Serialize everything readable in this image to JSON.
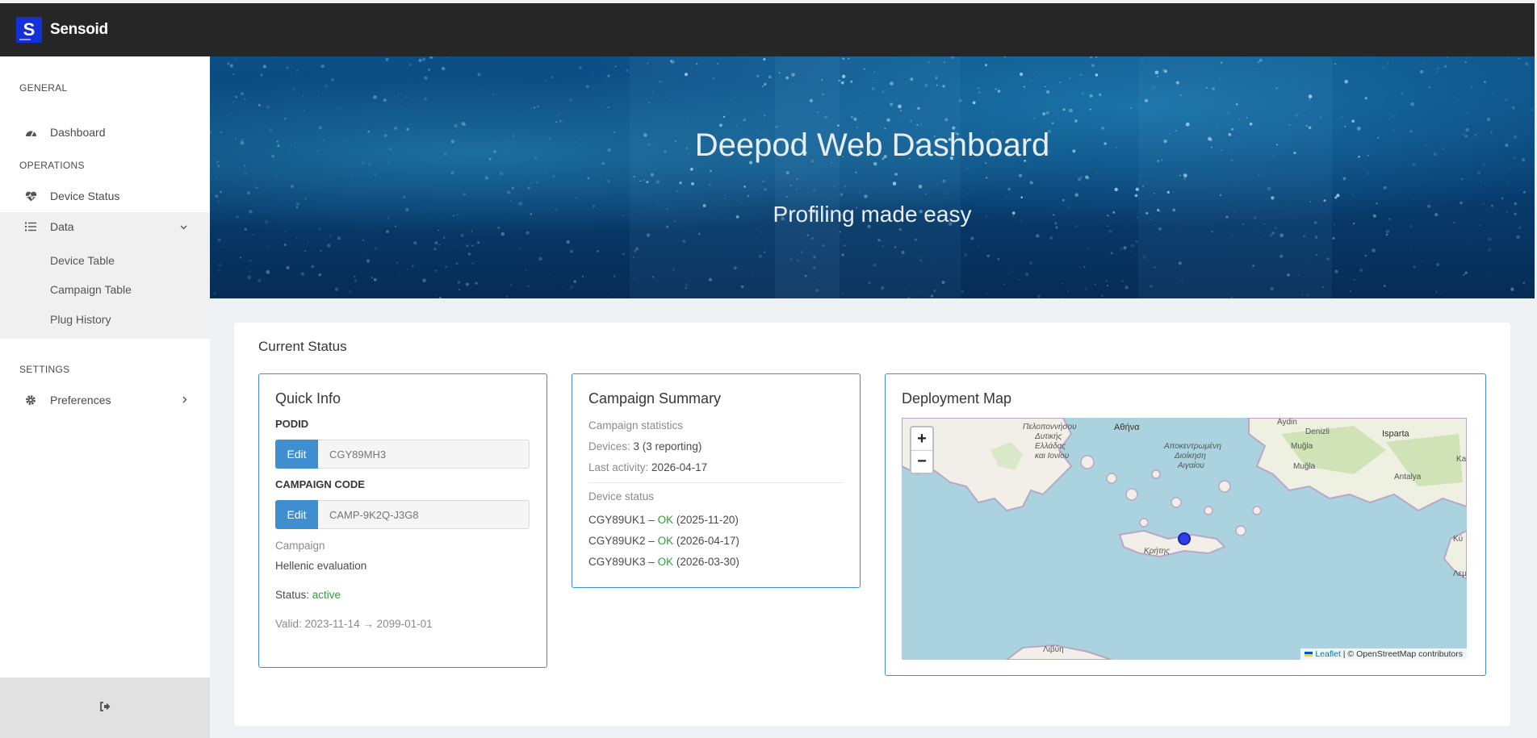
{
  "app": {
    "brand": "Sensoid",
    "logo_letter": "S"
  },
  "sidebar": {
    "sections": {
      "general": "GENERAL",
      "operations": "OPERATIONS",
      "settings": "SETTINGS"
    },
    "dashboard": "Dashboard",
    "device_status": "Device Status",
    "data": "Data",
    "data_items": [
      "Device Table",
      "Campaign Table",
      "Plug History"
    ],
    "preferences": "Preferences"
  },
  "hero": {
    "title": "Deepod Web Dashboard",
    "subtitle": "Profiling made easy"
  },
  "main": {
    "title": "Current Status",
    "quick_info": {
      "title": "Quick Info",
      "podid_label": "PODID",
      "podid_edit": "Edit",
      "podid_placeholder": "CGY89MH3",
      "campaign_code_label": "CAMPAIGN CODE",
      "campaign_code_edit": "Edit",
      "campaign_code_placeholder": "CAMP-9K2Q-J3G8",
      "campaign_label": "Campaign",
      "campaign_name": "Hellenic evaluation",
      "status_label": "Status:",
      "status_value": "active",
      "valid": "Valid: 2023-11-14 → 2099-01-01"
    },
    "campaign_summary": {
      "title": "Campaign Summary",
      "stats_label": "Campaign statistics",
      "devices_label": "Devices:",
      "devices_value": "3 (3 reporting)",
      "last_activity_label": "Last activity:",
      "last_activity_value": "2026-04-17",
      "device_status_label": "Device status",
      "devices": [
        {
          "id": "CGY89UK1",
          "sep": " – ",
          "status": "OK",
          "date": " (2025-11-20)"
        },
        {
          "id": "CGY89UK2",
          "sep": " – ",
          "status": "OK",
          "date": " (2026-04-17)"
        },
        {
          "id": "CGY89UK3",
          "sep": " – ",
          "status": "OK",
          "date": " (2026-03-30)"
        }
      ]
    },
    "deployment_map": {
      "title": "Deployment Map",
      "zoom_in": "+",
      "zoom_out": "−",
      "attribution_link": "Leaflet",
      "attribution_text": " | © OpenStreetMap contributors",
      "place_labels": [
        "Αθήνα",
        "Muğla",
        "Denizli",
        "Isparta",
        "Antalya",
        "Aydin",
        "Πελοποννήσου",
        "Δυτικής",
        "Ελλάδας",
        "και Ιονίου",
        "Αποκεντρωμένη",
        "Διοίκηση",
        "Αιγαίου",
        "Κρήτης",
        "Muğla",
        "Κύ",
        "Ka",
        "Λεμ",
        "Λιβύη"
      ]
    }
  }
}
